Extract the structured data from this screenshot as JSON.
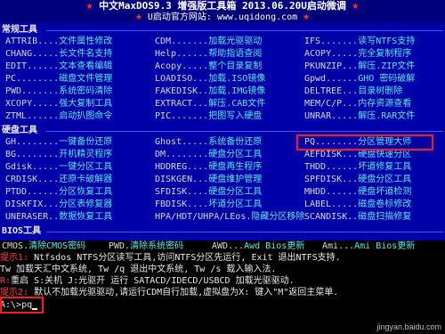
{
  "header": {
    "star_glyph": "★",
    "title": "中文MaxDOS9.3 增强版工具箱 2013.06.20U启动微调",
    "subtitle": "U启动官方网站: www.uqidong.com"
  },
  "sections": {
    "common_tools": "常规工具",
    "disk_tools": "硬盘工具",
    "bios_tools": "BIOS工具"
  },
  "common_rows": [
    [
      [
        "ATTRIB....",
        "文件属性修改"
      ],
      [
        "CDM.......",
        "加载光驱驱动"
      ],
      [
        "IFS.......",
        "读写NTFS支持"
      ]
    ],
    [
      [
        "CHANG.....",
        "长文件名支持"
      ],
      [
        "Help......",
        "帮助指语查阅"
      ],
      [
        "ACOPY.....",
        "完全复制程序"
      ]
    ],
    [
      [
        "EDIT......",
        "文本查看编辑"
      ],
      [
        "Acopy.....",
        "整个目录复制"
      ],
      [
        "PKUNZIP...",
        "解压.ZIP文件"
      ]
    ],
    [
      [
        "PC........",
        "磁盘文件管理"
      ],
      [
        "LOADISO...",
        "加载.ISO镜像"
      ],
      [
        "Gpwd......",
        "GHO 密码破解"
      ]
    ],
    [
      [
        "PWD.......",
        "系统密码清除"
      ],
      [
        "FAKEDISK..",
        "加载.IMG镜像"
      ],
      [
        "DELTREE...",
        "目录树删除"
      ]
    ],
    [
      [
        "XCOPY.....",
        "强大复制工具"
      ],
      [
        "EXTRACT...",
        "解压.CAB文件"
      ],
      [
        "MEM/C/P...",
        "内存资源查看"
      ]
    ],
    [
      [
        "ZTML......",
        "启动扒图命令"
      ],
      [
        "PIC.......",
        "把图写入硬盘"
      ],
      [
        "UNRAR.....",
        "解压.RAR文件"
      ]
    ]
  ],
  "disk_rows": [
    [
      [
        "GH........",
        "一键备份还原"
      ],
      [
        "Ghost.....",
        "系统备份还原"
      ],
      [
        "PQ........",
        "分区管理大师"
      ]
    ],
    [
      [
        "BG........",
        "开机精灵程序"
      ],
      [
        "DM........",
        "硬盘分区工具"
      ],
      [
        "AEFDISK...",
        "硬盘快速分区"
      ]
    ],
    [
      [
        "Gdisk.....",
        "一键分区工具"
      ],
      [
        "HDDREG....",
        "硬盘再生程序"
      ],
      [
        "THDD......",
        "坏道修复工具"
      ]
    ],
    [
      [
        "CRDISK....",
        "还原卡破解器"
      ],
      [
        "DISKGEN...",
        "硬盘维护管理"
      ],
      [
        "SPFDISK...",
        "硬盘分区工具"
      ]
    ],
    [
      [
        "PTDD......",
        "分区恢复工具"
      ],
      [
        "SFDISK....",
        "硬盘分区工具"
      ],
      [
        "MHDD......",
        "硬盘坏道检测"
      ]
    ],
    [
      [
        "DISKFIX...",
        "分区表修复器"
      ],
      [
        "FBDISK....",
        "坏道分区工具"
      ],
      [
        "LABEL.....",
        "磁盘卷标修改"
      ]
    ],
    [
      [
        "UNERASER..",
        "数据恢复工具"
      ],
      [
        "HPA/HDT/UHPA/LEos.",
        "隐藏分区移除"
      ],
      [
        "SCANDISK..",
        "磁盘扫描修复"
      ]
    ]
  ],
  "bios_row": [
    [
      "CMOS.",
      "清除CMOS密码"
    ],
    [
      "PWD.",
      "清除系统密码"
    ],
    [
      "AWD...",
      "Awd Bios更新"
    ],
    [
      "Ami...",
      "Ami Bios更新"
    ]
  ],
  "prompt": {
    "line1_tag": "提示1:",
    "line1_text": " Ntfsdos  NTFS分区读写工具,访问NTFS分区先运行, Exit 退出NTFS支持.",
    "line2": " Tw  加载天汇中文系统, Tw /q 退出中文系统,  Tw /s 载入输入法.",
    "line3_tag": "R:",
    "line3_text": "重启  S:关机    J:光驱开      运行 SATACD/IDECD/USBCD 加载光驱驱动.",
    "line4_tag": "提示2:",
    "line4_text": " 默认不加载光驱驱动,请运行CDM自行加载,虚拟盘为X:   键入\"M\"返回主菜单.",
    "prompt_label": "A:\\>",
    "input_value": "pq"
  },
  "watermark": "jingyan.baidu.com"
}
